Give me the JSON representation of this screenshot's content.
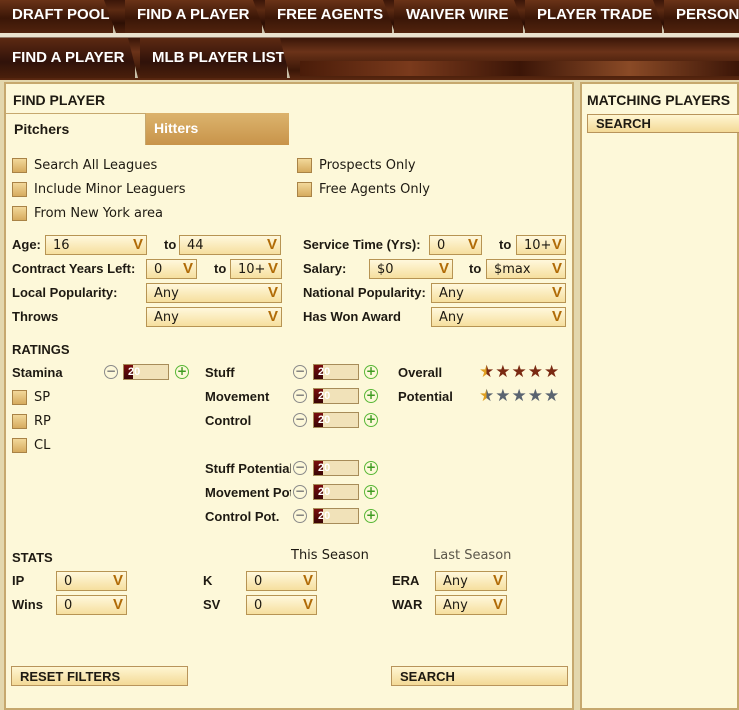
{
  "top_tabs": [
    "DRAFT POOL",
    "FIND A PLAYER",
    "FREE AGENTS",
    "WAIVER WIRE",
    "PLAYER TRADE",
    "PERSONNEL"
  ],
  "sub_tabs": [
    "FIND A PLAYER",
    "MLB PLAYER LIST"
  ],
  "find_player": {
    "title": "FIND PLAYER",
    "tabs": [
      "Pitchers",
      "Hitters"
    ],
    "checkboxes_left": [
      "Search All Leagues",
      "Include Minor Leaguers",
      "From New York area"
    ],
    "checkboxes_right": [
      "Prospects Only",
      "Free Agents Only"
    ],
    "age": {
      "label": "Age:",
      "from": "16",
      "to_label": "to",
      "to": "44"
    },
    "contract": {
      "label": "Contract Years Left:",
      "from": "0",
      "to_label": "to",
      "to": "10+"
    },
    "local_pop": {
      "label": "Local Popularity:",
      "value": "Any"
    },
    "throws": {
      "label": "Throws",
      "value": "Any"
    },
    "service": {
      "label": "Service Time (Yrs):",
      "from": "0",
      "to_label": "to",
      "to": "10+"
    },
    "salary": {
      "label": "Salary:",
      "from": "$0",
      "to_label": "to",
      "to": "$max"
    },
    "national_pop": {
      "label": "National Popularity:",
      "value": "Any"
    },
    "award": {
      "label": "Has Won Award",
      "value": "Any"
    },
    "ratings": {
      "title": "RATINGS",
      "stamina": {
        "label": "Stamina",
        "value": "20",
        "level": 0.2
      },
      "positions": [
        "SP",
        "RP",
        "CL"
      ],
      "sliders": [
        {
          "label": "Stuff",
          "value": "20",
          "level": 0.2
        },
        {
          "label": "Movement",
          "value": "20",
          "level": 0.2
        },
        {
          "label": "Control",
          "value": "20",
          "level": 0.2
        },
        {
          "label": "Stuff Potential",
          "value": "20",
          "level": 0.2
        },
        {
          "label": "Movement Potential",
          "value": "20",
          "level": 0.2
        },
        {
          "label": "Control Pot.",
          "value": "20",
          "level": 0.2
        }
      ],
      "overall": {
        "label": "Overall",
        "stars": 0.5,
        "max": 5
      },
      "potential": {
        "label": "Potential",
        "stars": 0.5,
        "max": 5
      }
    },
    "stats": {
      "title": "STATS",
      "this_season": "This Season",
      "last_season": "Last Season",
      "fields": [
        {
          "label": "IP",
          "value": "0"
        },
        {
          "label": "Wins",
          "value": "0"
        },
        {
          "label": "K",
          "value": "0"
        },
        {
          "label": "SV",
          "value": "0"
        },
        {
          "label": "ERA",
          "value": "Any"
        },
        {
          "label": "WAR",
          "value": "Any"
        }
      ]
    },
    "reset_button": "RESET FILTERS",
    "search_button": "SEARCH"
  },
  "matching": {
    "title": "MATCHING PLAYERS",
    "search_button": "SEARCH"
  },
  "colors": {
    "wood_dark": "#3a1607",
    "panel_bg": "#fdf8d9",
    "panel_border": "#c6a86e",
    "tab_active": "#d4a660",
    "slider_fill": "#6a0a0a",
    "plus_green": "#3e9b22"
  }
}
